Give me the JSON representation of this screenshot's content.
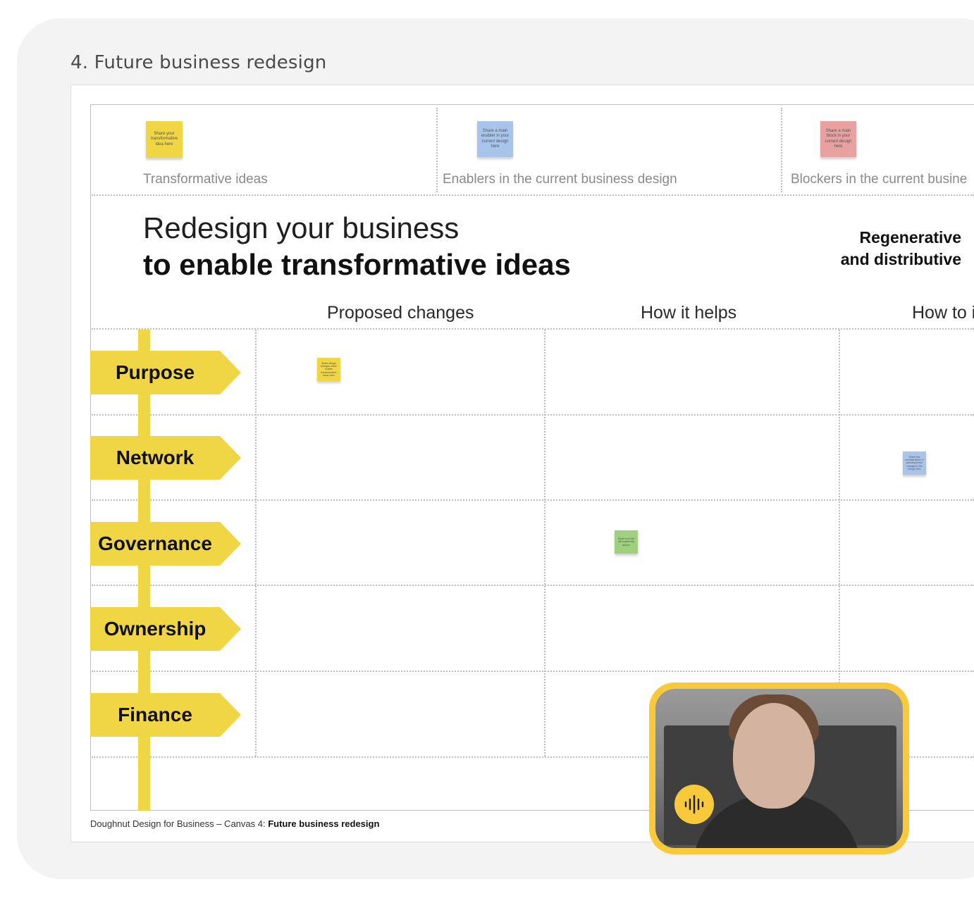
{
  "board": {
    "title": "4. Future business redesign"
  },
  "top_sections": [
    {
      "label": "Transformative ideas",
      "sticky": "Share your transformative idea here",
      "color": "#f0d544"
    },
    {
      "label": "Enablers in the current business design",
      "sticky": "Share a main enabler in your current design here",
      "color": "#a9c4ea"
    },
    {
      "label": "Blockers in the current busine",
      "sticky": "Share a main block in your current design here",
      "color": "#e8a0a0"
    }
  ],
  "headline": {
    "line1": "Redesign your business",
    "line2": "to enable transformative ideas"
  },
  "side_heading": {
    "line1": "Regenerative",
    "line2": "and distributive"
  },
  "columns": [
    "Proposed changes",
    "How it helps",
    "How to i"
  ],
  "rows": [
    "Purpose",
    "Network",
    "Governance",
    "Ownership",
    "Finance"
  ],
  "grid_stickies": [
    {
      "text": "Share design changes which enable transformative ideas here",
      "color": "#f0d544"
    },
    {
      "text": "Share how this will enable key actions",
      "color": "#9fd07e"
    },
    {
      "text": "Share key considerations in pursuing these changes to the design here",
      "color": "#a9c4ea"
    }
  ],
  "footer": {
    "prefix": "Doughnut Design for Business – Canvas 4: ",
    "bold": "Future business redesign"
  },
  "accent": "#f0d544",
  "video": {
    "border_color": "#f7c93b",
    "icon": "audio-waveform-icon"
  }
}
